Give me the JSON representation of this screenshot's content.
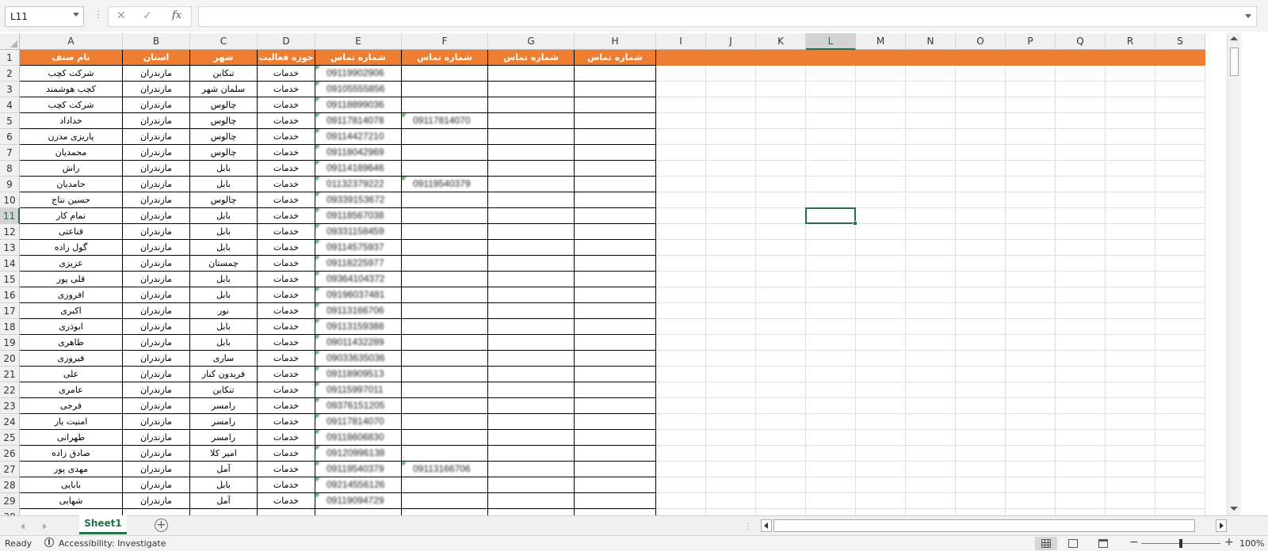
{
  "formula_bar": {
    "name_box": "L11",
    "formula": "",
    "cancel_glyph": "✕",
    "enter_glyph": "✓",
    "fx_glyph": "fx"
  },
  "grid": {
    "columns": [
      "A",
      "B",
      "C",
      "D",
      "E",
      "F",
      "G",
      "H",
      "I",
      "J",
      "K",
      "L",
      "M",
      "N",
      "O",
      "P",
      "Q",
      "R",
      "S"
    ],
    "selected_column": "L",
    "selected_row": 11,
    "selected_cell": "L11",
    "header_row": [
      "نام صنف",
      "استان",
      "شهر",
      "حوزه فعالیت",
      "شماره تماس",
      "شماره تماس",
      "شماره تماس",
      "شماره تماس"
    ],
    "rows": [
      {
        "n": 2,
        "a": "شرکت کچب",
        "b": "مازندران",
        "c": "تنکابن",
        "d": "خدمات",
        "e": "09119902906",
        "f": "",
        "g": "",
        "h": ""
      },
      {
        "n": 3,
        "a": "کچب هوشمند",
        "b": "مازندران",
        "c": "سلمان شهر",
        "d": "خدمات",
        "e": "09105555856",
        "f": "",
        "g": "",
        "h": ""
      },
      {
        "n": 4,
        "a": "شرکت کچب",
        "b": "مازندران",
        "c": "چالوس",
        "d": "خدمات",
        "e": "09118899036",
        "f": "",
        "g": "",
        "h": ""
      },
      {
        "n": 5,
        "a": "خداداد",
        "b": "مازندران",
        "c": "چالوس",
        "d": "خدمات",
        "e": "09117814078",
        "f": "09117814070",
        "g": "",
        "h": ""
      },
      {
        "n": 6,
        "a": "پاریزی مدرن",
        "b": "مازندران",
        "c": "چالوس",
        "d": "خدمات",
        "e": "09114427210",
        "f": "",
        "g": "",
        "h": ""
      },
      {
        "n": 7,
        "a": "محمدیان",
        "b": "مازندران",
        "c": "چالوس",
        "d": "خدمات",
        "e": "09118042969",
        "f": "",
        "g": "",
        "h": ""
      },
      {
        "n": 8,
        "a": "راش",
        "b": "مازندران",
        "c": "بابل",
        "d": "خدمات",
        "e": "09114189646",
        "f": "",
        "g": "",
        "h": ""
      },
      {
        "n": 9,
        "a": "حامدیان",
        "b": "مازندران",
        "c": "بابل",
        "d": "خدمات",
        "e": "01132379222",
        "f": "09119540379",
        "g": "",
        "h": ""
      },
      {
        "n": 10,
        "a": "حسین نتاج",
        "b": "مازندران",
        "c": "چالوس",
        "d": "خدمات",
        "e": "09339153672",
        "f": "",
        "g": "",
        "h": ""
      },
      {
        "n": 11,
        "a": "تمام کار",
        "b": "مازندران",
        "c": "بابل",
        "d": "خدمات",
        "e": "09118567038",
        "f": "",
        "g": "",
        "h": ""
      },
      {
        "n": 12,
        "a": "قناعتی",
        "b": "مازندران",
        "c": "بابل",
        "d": "خدمات",
        "e": "09331158459",
        "f": "",
        "g": "",
        "h": ""
      },
      {
        "n": 13,
        "a": "گول زاده",
        "b": "مازندران",
        "c": "بابل",
        "d": "خدمات",
        "e": "09114575937",
        "f": "",
        "g": "",
        "h": ""
      },
      {
        "n": 14,
        "a": "عزیزی",
        "b": "مازندران",
        "c": "چمستان",
        "d": "خدمات",
        "e": "09118225977",
        "f": "",
        "g": "",
        "h": ""
      },
      {
        "n": 15,
        "a": "قلی پور",
        "b": "مازندران",
        "c": "بابل",
        "d": "خدمات",
        "e": "09364104372",
        "f": "",
        "g": "",
        "h": ""
      },
      {
        "n": 16,
        "a": "افروزی",
        "b": "مازندران",
        "c": "بابل",
        "d": "خدمات",
        "e": "09196037481",
        "f": "",
        "g": "",
        "h": ""
      },
      {
        "n": 17,
        "a": "اکبری",
        "b": "مازندران",
        "c": "نور",
        "d": "خدمات",
        "e": "09113166706",
        "f": "",
        "g": "",
        "h": ""
      },
      {
        "n": 18,
        "a": "ابوذری",
        "b": "مازندران",
        "c": "بابل",
        "d": "خدمات",
        "e": "09113159388",
        "f": "",
        "g": "",
        "h": ""
      },
      {
        "n": 19,
        "a": "طاهری",
        "b": "مازندران",
        "c": "بابل",
        "d": "خدمات",
        "e": "09011432289",
        "f": "",
        "g": "",
        "h": ""
      },
      {
        "n": 20,
        "a": "فیروزی",
        "b": "مازندران",
        "c": "ساری",
        "d": "خدمات",
        "e": "09033635036",
        "f": "",
        "g": "",
        "h": ""
      },
      {
        "n": 21,
        "a": "علی",
        "b": "مازندران",
        "c": "فریدون کنار",
        "d": "خدمات",
        "e": "09118909513",
        "f": "",
        "g": "",
        "h": ""
      },
      {
        "n": 22,
        "a": "عامری",
        "b": "مازندران",
        "c": "تنکابن",
        "d": "خدمات",
        "e": "09115997011",
        "f": "",
        "g": "",
        "h": ""
      },
      {
        "n": 23,
        "a": "فرجی",
        "b": "مازندران",
        "c": "رامسر",
        "d": "خدمات",
        "e": "09376151205",
        "f": "",
        "g": "",
        "h": ""
      },
      {
        "n": 24,
        "a": "امنیت یار",
        "b": "مازندران",
        "c": "رامسر",
        "d": "خدمات",
        "e": "09117814070",
        "f": "",
        "g": "",
        "h": ""
      },
      {
        "n": 25,
        "a": "طهرانی",
        "b": "مازندران",
        "c": "رامسر",
        "d": "خدمات",
        "e": "09118606830",
        "f": "",
        "g": "",
        "h": ""
      },
      {
        "n": 26,
        "a": "صادق زاده",
        "b": "مازندران",
        "c": "امیر کلا",
        "d": "خدمات",
        "e": "09120996138",
        "f": "",
        "g": "",
        "h": ""
      },
      {
        "n": 27,
        "a": "مهدی پور",
        "b": "مازندران",
        "c": "آمل",
        "d": "خدمات",
        "e": "09119540379",
        "f": "09113166706",
        "g": "",
        "h": ""
      },
      {
        "n": 28,
        "a": "بابایی",
        "b": "مازندران",
        "c": "بابل",
        "d": "خدمات",
        "e": "09214556126",
        "f": "",
        "g": "",
        "h": ""
      },
      {
        "n": 29,
        "a": "شهابی",
        "b": "مازندران",
        "c": "آمل",
        "d": "خدمات",
        "e": "09119094729",
        "f": "",
        "g": "",
        "h": ""
      }
    ],
    "flags_f": [
      5,
      9,
      27
    ],
    "flags_g": []
  },
  "sheets": {
    "tabs": [
      "Sheet1"
    ],
    "add_glyph": "+",
    "separator_glyph": "⋮"
  },
  "status_bar": {
    "ready": "Ready",
    "accessibility": "Accessibility: Investigate",
    "zoom_minus": "−",
    "zoom_plus": "+",
    "zoom": "100%"
  },
  "colors": {
    "header_fill": "#ed7d31",
    "selection": "#217346"
  }
}
